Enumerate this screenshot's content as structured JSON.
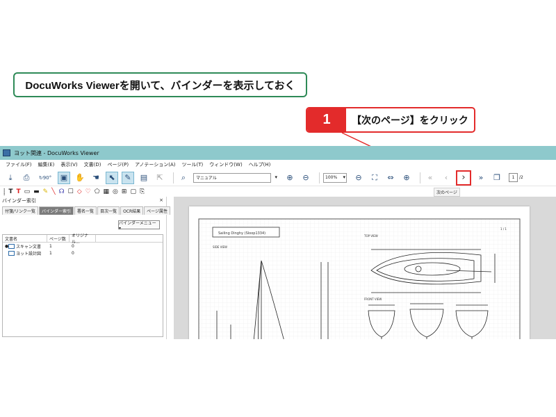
{
  "instruction": "DocuWorks Viewerを開いて、バインダーを表示しておく",
  "step": {
    "number": "1",
    "text": "【次のページ】をクリック"
  },
  "window": {
    "title": "ヨット関連 - DocuWorks Viewer",
    "menu": [
      "ファイル(F)",
      "編集(E)",
      "表示(V)",
      "文書(D)",
      "ページ(P)",
      "アノテーション(A)",
      "ツール(T)",
      "ウィンドウ(W)",
      "ヘルプ(H)"
    ]
  },
  "toolbar": {
    "rotate_label": "90°",
    "zoom_mode": "マニュアル",
    "zoom_percent": "100%",
    "page_current": "1",
    "page_total": "/2",
    "next_page_tooltip": "次のページ",
    "prev_page_glyph": "‹",
    "next_page_glyph": "›"
  },
  "binder_panel": {
    "title": "バインダー索引",
    "close": "×",
    "tabs": [
      "付箋/リンク一覧",
      "バインダー索引",
      "署名一覧",
      "目次一覧",
      "OCR結果",
      "ページ属性"
    ],
    "active_tab": 1,
    "menu_button": "バインダーメニュー ▾",
    "columns": [
      "文書名",
      "ページ数",
      "オリジナル..."
    ],
    "rows": [
      {
        "name": "スキャン文書",
        "pages": "1",
        "original": "0"
      },
      {
        "name": "ヨット設計図",
        "pages": "1",
        "original": "0"
      }
    ]
  },
  "drawing": {
    "title": "Sailing Dinghy (Sloop1334)",
    "page_no": "1 / 1",
    "side_view": "SIDE VIEW",
    "top_view": "TOP VIEW",
    "front_view": "FRONT VIEW"
  },
  "colors": {
    "accent_red": "#e32b2b",
    "green_border": "#2e8a57",
    "title_bar": "#8ec9cc"
  }
}
